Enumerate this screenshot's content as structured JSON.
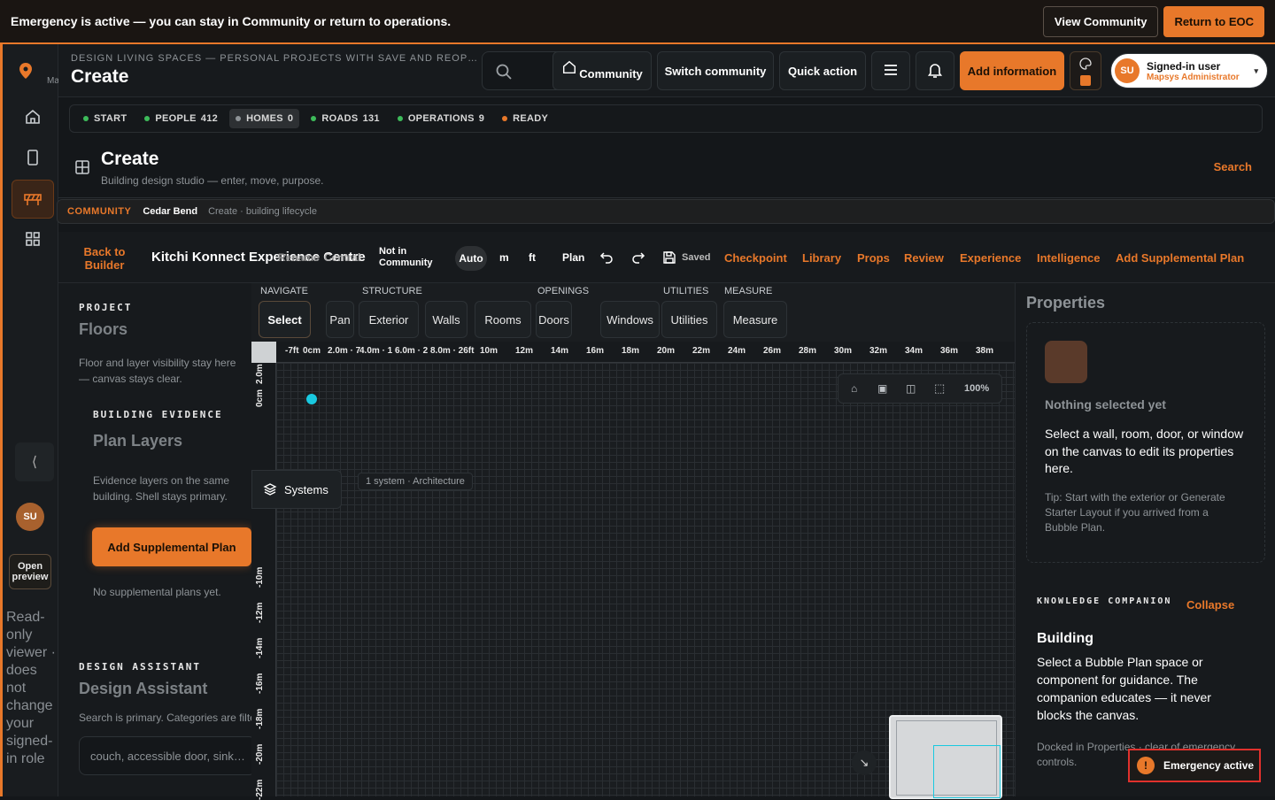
{
  "banner": {
    "message": "Emergency is active — you can stay in Community or return to operations.",
    "view_community": "View Community",
    "return_eoc": "Return to EOC"
  },
  "rail": {
    "logo_suffix": "Ma",
    "avatar": "SU",
    "open_preview": "Open preview",
    "readonly_note": "Read-only viewer · does not change your signed-in role"
  },
  "topbar": {
    "crumb": "DESIGN LIVING SPACES — PERSONAL PROJECTS WITH SAVE AND REOP…",
    "title": "Create",
    "community": "Community",
    "switch_community": "Switch community",
    "quick_action": "Quick action",
    "add_information": "Add information",
    "user_name": "Signed-in user",
    "user_role": "Mapsys Administrator",
    "avatar": "SU"
  },
  "status": {
    "items": [
      {
        "label": "START",
        "count": "",
        "color": "#3dbb5a"
      },
      {
        "label": "PEOPLE",
        "count": "412",
        "color": "#3dbb5a"
      },
      {
        "label": "HOMES",
        "count": "0",
        "color": "#8e9397"
      },
      {
        "label": "ROADS",
        "count": "131",
        "color": "#3dbb5a"
      },
      {
        "label": "OPERATIONS",
        "count": "9",
        "color": "#3dbb5a"
      },
      {
        "label": "READY",
        "count": "",
        "color": "#e8782a"
      }
    ]
  },
  "header": {
    "title": "Create",
    "subtitle": "Building design studio — enter, move, purpose.",
    "search": "Search"
  },
  "commbar": {
    "community": "COMMUNITY",
    "name": "Cedar Bend",
    "context": "Create · building lifecycle"
  },
  "toolbar": {
    "back": "Back to Builder",
    "project": "Kitchi Konnect Experience Centre",
    "rename": "Rename",
    "central": "Central",
    "not_in": "Not in Community",
    "auto": "Auto",
    "m": "m",
    "ft": "ft",
    "plan": "Plan",
    "saved": "Saved",
    "checkpoint": "Checkpoint",
    "library": "Library",
    "props": "Props",
    "review": "Review",
    "experience": "Experience",
    "intelligence": "Intelligence",
    "add_supplemental": "Add Supplemental Plan"
  },
  "left": {
    "project_head": "PROJECT",
    "floors": "Floors",
    "floors_note": "Floor and layer visibility stay here — canvas stays clear.",
    "evidence_head": "BUILDING EVIDENCE",
    "plan_layers": "Plan Layers",
    "plan_layers_note": "Evidence layers on the same building. Shell stays primary.",
    "add_supplemental": "Add Supplemental Plan",
    "no_plans": "No supplemental plans yet.",
    "assistant_head": "DESIGN ASSISTANT",
    "assistant_title": "Design Assistant",
    "assistant_note": "Search is primary. Categories are filters.",
    "search_placeholder": "couch, accessible door, sink…"
  },
  "tools": {
    "groups": {
      "navigate": "NAVIGATE",
      "structure": "STRUCTURE",
      "openings": "OPENINGS",
      "utilities": "UTILITIES",
      "measure": "MEASURE"
    },
    "buttons": [
      "Select",
      "Pan",
      "Exterior",
      "Walls",
      "Rooms",
      "Doors",
      "Windows",
      "Utilities",
      "Measure"
    ]
  },
  "ruler": {
    "top": [
      "-7ft",
      "0cm",
      "2.0m · 7",
      "4.0m · 1",
      "6.0m · 2",
      "8.0m · 26ft",
      "10m",
      "12m",
      "14m",
      "16m",
      "18m",
      "20m",
      "22m",
      "24m",
      "26m",
      "28m",
      "30m",
      "32m",
      "34m",
      "36m",
      "38m"
    ],
    "left": [
      "0cm",
      "2.0m",
      "-10m",
      "-12m",
      "-14m",
      "-16m",
      "-18m",
      "-20m",
      "-22m"
    ]
  },
  "canvas": {
    "zoom": "100%",
    "systems": "Systems",
    "system_note": "1 system · Architecture"
  },
  "right": {
    "properties": "Properties",
    "nothing": "Nothing selected yet",
    "instruction": "Select a wall, room, door, or window on the canvas to edit its properties here.",
    "tip": "Tip: Start with the exterior or Generate Starter Layout if you arrived from a Bubble Plan.",
    "kc_head": "KNOWLEDGE COMPANION",
    "collapse": "Collapse",
    "building": "Building",
    "kc_text": "Select a Bubble Plan space or component for guidance. The companion educates — it never blocks the canvas.",
    "docked": "Docked in Properties · clear of emergency controls."
  },
  "emergency": {
    "label": "Emergency active"
  },
  "colors": {
    "accent": "#e8782a",
    "danger": "#e0312d",
    "cyan": "#19c9e0"
  }
}
